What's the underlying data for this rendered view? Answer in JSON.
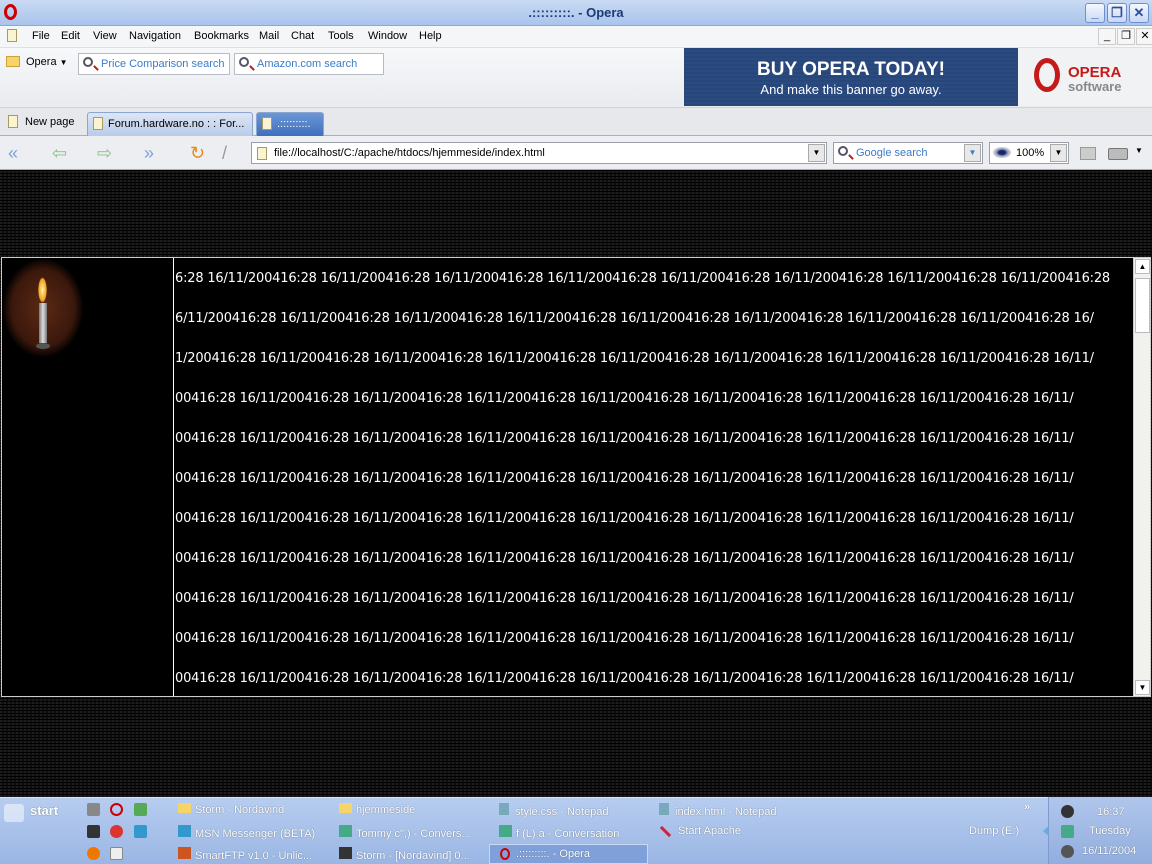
{
  "window": {
    "title": ".:::::::::. - Opera",
    "min": "_",
    "restore": "❐",
    "close": "✕"
  },
  "menu": [
    "File",
    "Edit",
    "View",
    "Navigation",
    "Bookmarks",
    "Mail",
    "Chat",
    "Tools",
    "Window",
    "Help"
  ],
  "toolbar": {
    "opera_menu": "Opera",
    "search1": "Price Comparison search",
    "search2": "Amazon.com search"
  },
  "banner": {
    "headline": "BUY OPERA TODAY!",
    "sub": "And make this banner go away.",
    "logo_top": "OPERA",
    "logo_bottom": "software"
  },
  "tabs": {
    "new_page": "New page",
    "items": [
      {
        "label": "Forum.hardware.no : : For..."
      },
      {
        "label": ".:::::::::.",
        "active": true
      }
    ]
  },
  "nav": {
    "address": "file://localhost/C:/apache/htdocs/hjemmeside/index.html",
    "search_placeholder": "Google search",
    "zoom": "100%"
  },
  "page": {
    "rows": [
      "6:28 16/11/200416:28 16/11/200416:28 16/11/200416:28 16/11/200416:28 16/11/200416:28 16/11/200416:28 16/11/200416:28 16/11/200416:28",
      "6/11/200416:28 16/11/200416:28 16/11/200416:28 16/11/200416:28 16/11/200416:28 16/11/200416:28 16/11/200416:28 16/11/200416:28 16/",
      "1/200416:28 16/11/200416:28 16/11/200416:28 16/11/200416:28 16/11/200416:28 16/11/200416:28 16/11/200416:28 16/11/200416:28 16/11/",
      "00416:28 16/11/200416:28 16/11/200416:28 16/11/200416:28 16/11/200416:28 16/11/200416:28 16/11/200416:28 16/11/200416:28 16/11/",
      "00416:28 16/11/200416:28 16/11/200416:28 16/11/200416:28 16/11/200416:28 16/11/200416:28 16/11/200416:28 16/11/200416:28 16/11/",
      "00416:28 16/11/200416:28 16/11/200416:28 16/11/200416:28 16/11/200416:28 16/11/200416:28 16/11/200416:28 16/11/200416:28 16/11/",
      "00416:28 16/11/200416:28 16/11/200416:28 16/11/200416:28 16/11/200416:28 16/11/200416:28 16/11/200416:28 16/11/200416:28 16/11/",
      "00416:28 16/11/200416:28 16/11/200416:28 16/11/200416:28 16/11/200416:28 16/11/200416:28 16/11/200416:28 16/11/200416:28 16/11/",
      "00416:28 16/11/200416:28 16/11/200416:28 16/11/200416:28 16/11/200416:28 16/11/200416:28 16/11/200416:28 16/11/200416:28 16/11/",
      "00416:28 16/11/200416:28 16/11/200416:28 16/11/200416:28 16/11/200416:28 16/11/200416:28 16/11/200416:28 16/11/200416:28 16/11/",
      "00416:28 16/11/200416:28 16/11/200416:28 16/11/200416:28 16/11/200416:28 16/11/200416:28 16/11/200416:28 16/11/200416:28 16/11/"
    ]
  },
  "taskbar": {
    "start": "start",
    "more": "»",
    "drive": "Dump (E:)",
    "buttons": [
      [
        "Storm - Nordavind",
        "hjemmeside",
        "style.css - Notepad",
        "index.html - Notepad"
      ],
      [
        "MSN Messenger (BETA)",
        "Tommy c\",) - Convers...",
        "f  (L) a - Conversation",
        "Start Apache"
      ],
      [
        "SmartFTP v1.0 - Unlic...",
        "Storm - [Nordavind] 0...",
        ".:::::::::. - Opera"
      ]
    ],
    "clock": {
      "time": "16:37",
      "day": "Tuesday",
      "date": "16/11/2004"
    }
  },
  "colors": {
    "banner": "#27467a",
    "page_bg": "#000000",
    "text": "#ffffff",
    "taskbar": "#9ab6e4"
  }
}
